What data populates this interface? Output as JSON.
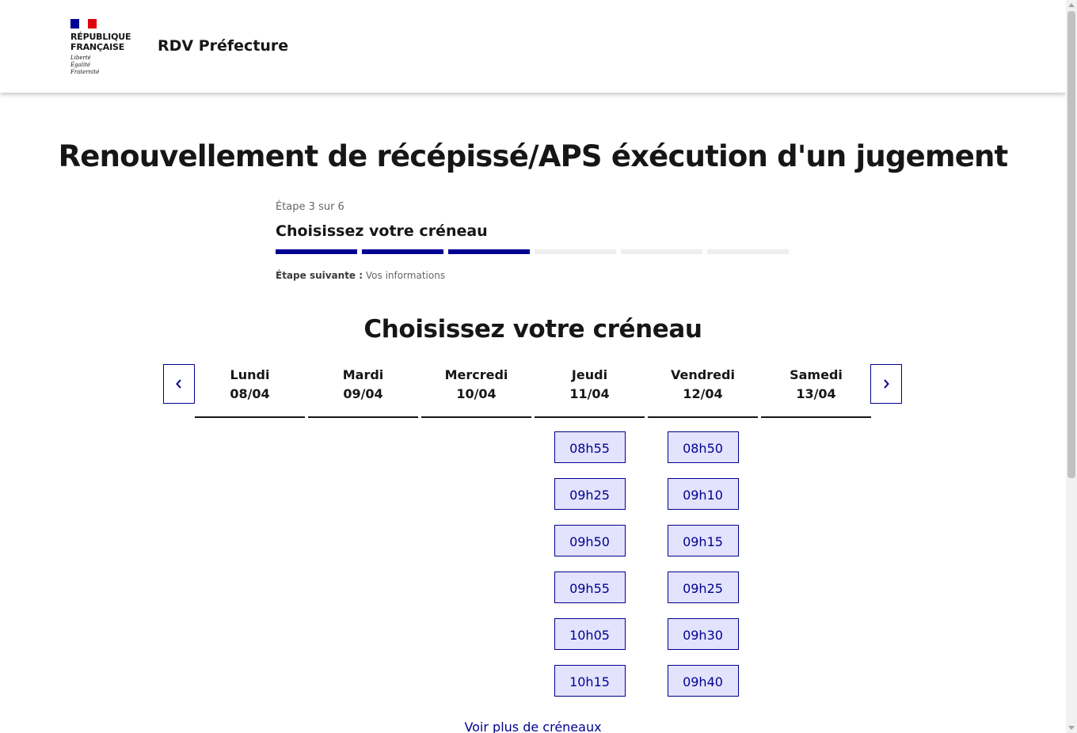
{
  "header": {
    "logo_line1": "RÉPUBLIQUE",
    "logo_line2": "FRANÇAISE",
    "motto": [
      "Liberté",
      "Égalité",
      "Fraternité"
    ],
    "service_title": "RDV Préfecture"
  },
  "page_title": "Renouvellement de récépissé/APS éxécution d'un jugement",
  "stepper": {
    "state": "Étape 3 sur 6",
    "title": "Choisissez votre créneau",
    "current_step": 3,
    "total_steps": 6,
    "next_label": "Étape suivante :",
    "next_value": "Vos informations"
  },
  "section_title": "Choisissez votre créneau",
  "days": [
    {
      "name": "Lundi",
      "date": "08/04",
      "slots": []
    },
    {
      "name": "Mardi",
      "date": "09/04",
      "slots": []
    },
    {
      "name": "Mercredi",
      "date": "10/04",
      "slots": []
    },
    {
      "name": "Jeudi",
      "date": "11/04",
      "slots": [
        "08h55",
        "09h25",
        "09h50",
        "09h55",
        "10h05",
        "10h15"
      ]
    },
    {
      "name": "Vendredi",
      "date": "12/04",
      "slots": [
        "08h50",
        "09h10",
        "09h15",
        "09h25",
        "09h30",
        "09h40"
      ]
    },
    {
      "name": "Samedi",
      "date": "13/04",
      "slots": []
    }
  ],
  "more_link": "Voir plus de créneaux",
  "colors": {
    "primary": "#000091",
    "slot_background": "#e3e3fd",
    "flag_red": "#e1000f",
    "text": "#161616"
  },
  "icons": {
    "prev": "chevron-left-icon",
    "next": "chevron-right-icon"
  }
}
